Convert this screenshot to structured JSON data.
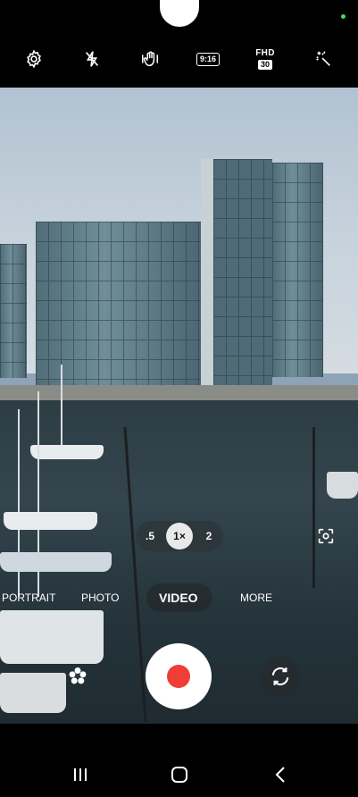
{
  "status": {
    "indicator_color": "#3ee05f"
  },
  "top_controls": {
    "settings_icon": "gear-icon",
    "flash_icon": "flash-off-icon",
    "stabilize_icon": "hand-stabilize-icon",
    "aspect_ratio": "9:16",
    "resolution": "FHD",
    "fps": "30",
    "effects_icon": "magic-wand-icon"
  },
  "zoom": {
    "options": [
      ".5",
      "1×",
      "2"
    ],
    "selected": "1×"
  },
  "modes": {
    "items": [
      "PORTRAIT",
      "PHOTO",
      "VIDEO",
      "MORE"
    ],
    "active": "VIDEO"
  },
  "bottom_controls": {
    "filter_icon": "flower-filter-icon",
    "record_color": "#ef3e36",
    "flip_icon": "switch-camera-icon",
    "focus_icon": "scene-optimizer-icon"
  },
  "navigation": {
    "recents_icon": "recent-apps-icon",
    "home_icon": "home-icon",
    "back_icon": "back-icon"
  }
}
